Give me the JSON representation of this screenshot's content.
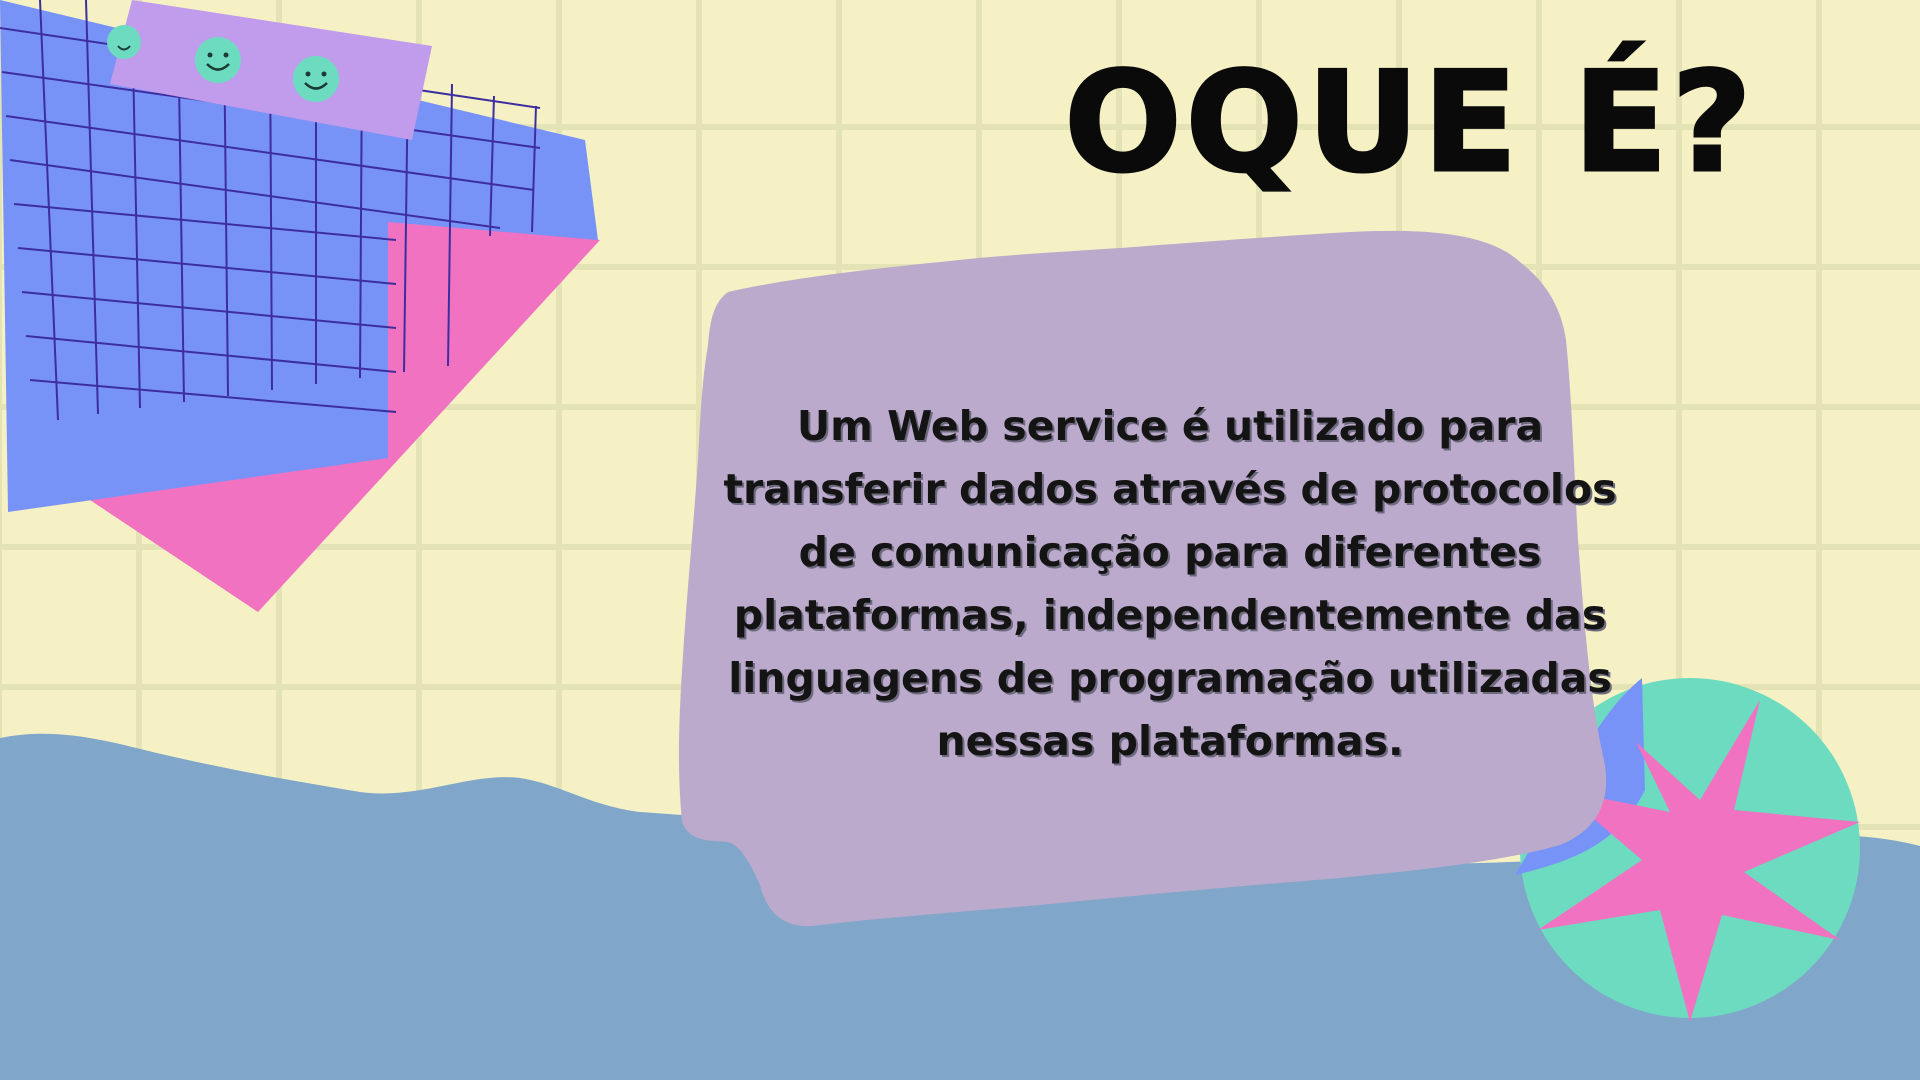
{
  "slide": {
    "title": "OQUE É?",
    "body": "Um Web service é utilizado para transferir dados através de protocolos de comunicação para diferentes plataformas, independentemente das linguagens de programação utilizadas nessas plataformas."
  },
  "decorations": [
    {
      "name": "blue-grid-paper",
      "color": "#7893f7"
    },
    {
      "name": "pink-triangle",
      "color": "#f172c1"
    },
    {
      "name": "purple-tape-with-smileys",
      "color": "#c19bec"
    },
    {
      "name": "smiley-face-icon",
      "color": "#6ddbc0"
    },
    {
      "name": "torn-paper-card",
      "color": "#bbaacb"
    },
    {
      "name": "blue-wave-bottom",
      "color": "#80a6ca"
    },
    {
      "name": "star-badge",
      "color": "#6ddbc0",
      "accent": "#f172c1"
    }
  ]
}
